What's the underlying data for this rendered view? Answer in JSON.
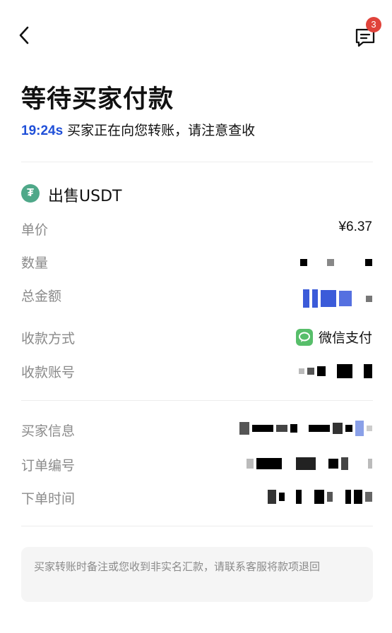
{
  "colors": {
    "accent": "#1f4fd8",
    "badge": "#e0433b",
    "tether": "#4fa889",
    "wechat": "#57be6a",
    "muted": "#8a8a8a",
    "notice_bg": "#f5f5f5",
    "mask_blue": "#3b5bd9"
  },
  "header": {
    "back_icon": "chevron-left-icon",
    "message_icon": "message-icon",
    "badge_count": "3"
  },
  "status": {
    "title": "等待买家付款",
    "countdown": "19:24s",
    "subtitle": "买家正在向您转账，请注意查收"
  },
  "order": {
    "sell_title": "出售USDT",
    "coin_icon": "tether-icon",
    "coin_symbol": "₮",
    "price_label": "单价",
    "price_value": "¥6.37",
    "quantity_label": "数量",
    "total_label": "总金额",
    "payment_method_label": "收款方式",
    "payment_method_value": "微信支付",
    "account_label": "收款账号"
  },
  "buyer": {
    "buyer_info_label": "买家信息",
    "order_no_label": "订单编号",
    "order_time_label": "下单时间"
  },
  "notice": {
    "text": "买家转账时备注或您收到非实名汇款，请联系客服将款项退回"
  }
}
